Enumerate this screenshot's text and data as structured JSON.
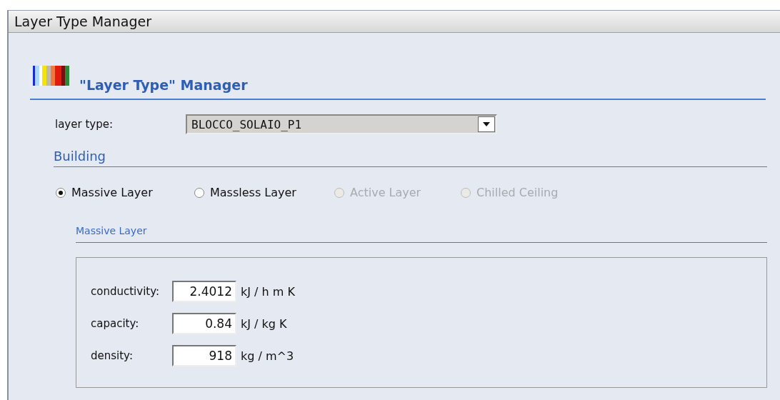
{
  "window": {
    "title": "Layer Type Manager"
  },
  "header": {
    "title": "\"Layer Type\" Manager"
  },
  "layer_type": {
    "label": "layer type:",
    "value": "BLOCCO_SOLAIO_P1"
  },
  "section": {
    "title": "Building"
  },
  "layer_kinds": [
    {
      "label": "Massive Layer",
      "selected": true,
      "disabled": false
    },
    {
      "label": "Massless Layer",
      "selected": false,
      "disabled": false
    },
    {
      "label": "Active Layer",
      "selected": false,
      "disabled": true
    },
    {
      "label": "Chilled Ceiling",
      "selected": false,
      "disabled": true
    }
  ],
  "subsection": {
    "title": "Massive Layer"
  },
  "properties": [
    {
      "label": "conductivity:",
      "value": "2.4012",
      "unit": "kJ / h m K"
    },
    {
      "label": "capacity:",
      "value": "0.84",
      "unit": "kJ / kg K"
    },
    {
      "label": "density:",
      "value": "918",
      "unit": "kg / m^3"
    }
  ]
}
